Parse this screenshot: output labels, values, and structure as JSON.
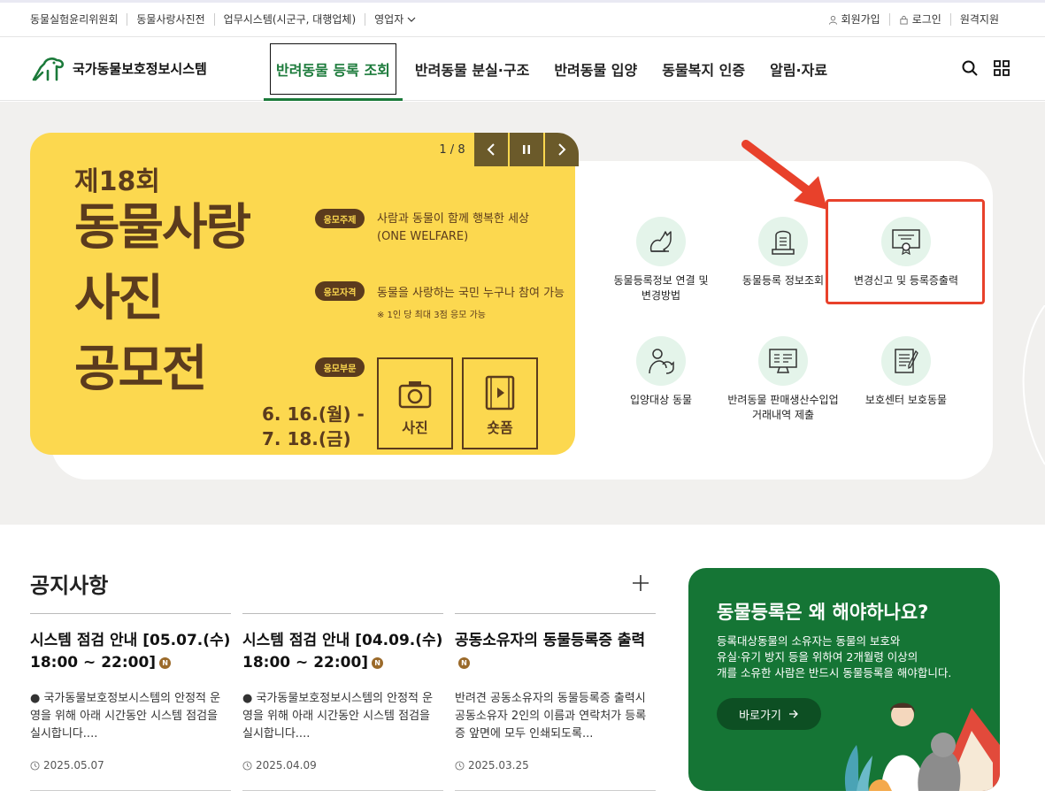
{
  "util_bar": {
    "left_links": [
      "동물실험윤리위원회",
      "동물사랑사진전",
      "업무시스템(시군구, 대행업체)",
      "영업자"
    ],
    "right_links": [
      {
        "label": "회원가입",
        "icon": "person-icon"
      },
      {
        "label": "로그인",
        "icon": "lock-icon"
      },
      {
        "label": "원격지원",
        "icon": ""
      }
    ]
  },
  "header": {
    "logo_text": "국가동물보호정보시스템",
    "nav": [
      "반려동물 등록 조회",
      "반려동물 분실·구조",
      "반려동물 입양",
      "동물복지 인증",
      "알림·자료"
    ],
    "active_nav_index": 0
  },
  "banner": {
    "pager": "1 / 8",
    "title_line1": "제18회",
    "title_big": [
      "동물사랑",
      "사진",
      "공모전"
    ],
    "tags": [
      "응모주제",
      "응모자격",
      "응모부문"
    ],
    "theme_line1": "사람과 동물이 함께 행복한 세상",
    "theme_line2": "(ONE WELFARE)",
    "eligibility": "동물을 사랑하는 국민 누구나 참여 가능",
    "eligibility_note": "※ 1인 당 최대 3점 응모 가능",
    "date_line1": "6. 16.(월) -",
    "date_line2": "7. 18.(금)",
    "categories": [
      "사진",
      "숏폼"
    ]
  },
  "quick_services": [
    {
      "label_line1": "동물등록정보 연결 및",
      "label_line2": "변경방법",
      "icon": "cat-icon"
    },
    {
      "label_line1": "동물등록 정보조회",
      "label_line2": "",
      "icon": "tombstone-icon"
    },
    {
      "label_line1": "변경신고 및 등록증출력",
      "label_line2": "",
      "icon": "certificate-icon"
    },
    {
      "label_line1": "입양대상 동물",
      "label_line2": "",
      "icon": "person-with-dog-icon"
    },
    {
      "label_line1": "반려동물 판매생산수입업",
      "label_line2": "거래내역 제출",
      "icon": "monitor-report-icon"
    },
    {
      "label_line1": "보호센터 보호동물",
      "label_line2": "",
      "icon": "notepad-icon"
    }
  ],
  "notices": {
    "title": "공지사항",
    "items": [
      {
        "title": "시스템 점검 안내 [05.07.(수) 18:00 ~ 22:00]",
        "badge": "N",
        "body": "● 국가동물보호정보시스템의 안정적 운영을 위해 아래 시간동안 시스템 점검을 실시합니다....",
        "date": "2025.05.07"
      },
      {
        "title": "시스템 점검 안내 [04.09.(수) 18:00 ~ 22:00]",
        "badge": "N",
        "body": "● 국가동물보호정보시스템의 안정적 운영을 위해 아래 시간동안 시스템 점검을 실시합니다....",
        "date": "2025.04.09"
      },
      {
        "title": "공동소유자의 동물등록증 출력",
        "badge": "N",
        "body": "반려견 공동소유자의 동물등록증 출력시 공동소유자 2인의 이름과 연락처가 등록증 앞면에 모두 인쇄되도록...",
        "date": "2025.03.25"
      }
    ]
  },
  "promo": {
    "title": "동물등록은 왜 해야하나요?",
    "desc_line1": "등록대상동물의 소유자는 동물의 보호와",
    "desc_line2": "유실·유기 방지 등을 위하여 2개월령 이상의",
    "desc_line3": "개를 소유한 사람은 반드시 동물등록을 해야합니다.",
    "button": "바로가기"
  },
  "colors": {
    "brand_green": "#1b7a3a",
    "promo_green": "#157535",
    "banner_yellow": "#fcd84f",
    "banner_brown": "#5b3b1d",
    "highlight_red": "#e8412b"
  }
}
